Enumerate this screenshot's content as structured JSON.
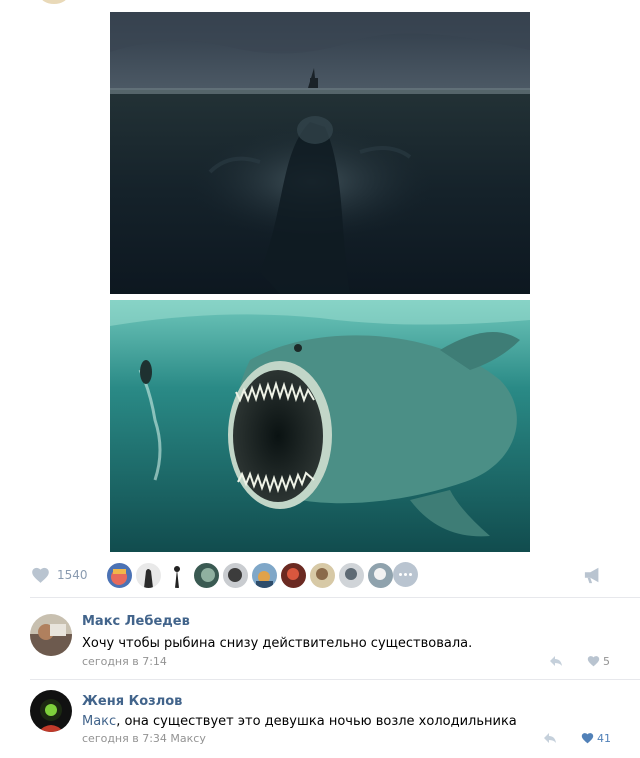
{
  "post": {
    "images": [
      {
        "name": "ship-storm-sea-creature-photo"
      },
      {
        "name": "giant-fish-diver-photo"
      }
    ],
    "likes": {
      "count": "1540",
      "likers": [
        "liker-1",
        "liker-2",
        "liker-3",
        "liker-4",
        "liker-5",
        "liker-6",
        "liker-7",
        "liker-8",
        "liker-9",
        "liker-10"
      ]
    },
    "icons": {
      "like": "heart-icon",
      "share": "megaphone-icon",
      "more": "more-dots-icon"
    }
  },
  "comments": [
    {
      "author": "Макс Лебедев",
      "text": "Хочу чтобы рыбина снизу действительно существовала.",
      "time": "сегодня в 7:14",
      "likes": "5",
      "liked": false
    },
    {
      "author": "Женя Козлов",
      "mention": "Макс",
      "text": ", она существует это девушка ночью возле холодильника",
      "time": "сегодня в 7:34",
      "reply_to": "Максу",
      "likes": "41",
      "liked": true
    }
  ],
  "colors": {
    "accent": "#42648b",
    "muted": "#939393",
    "like_active": "#5181b8",
    "like_inactive": "#b9c4d0"
  }
}
